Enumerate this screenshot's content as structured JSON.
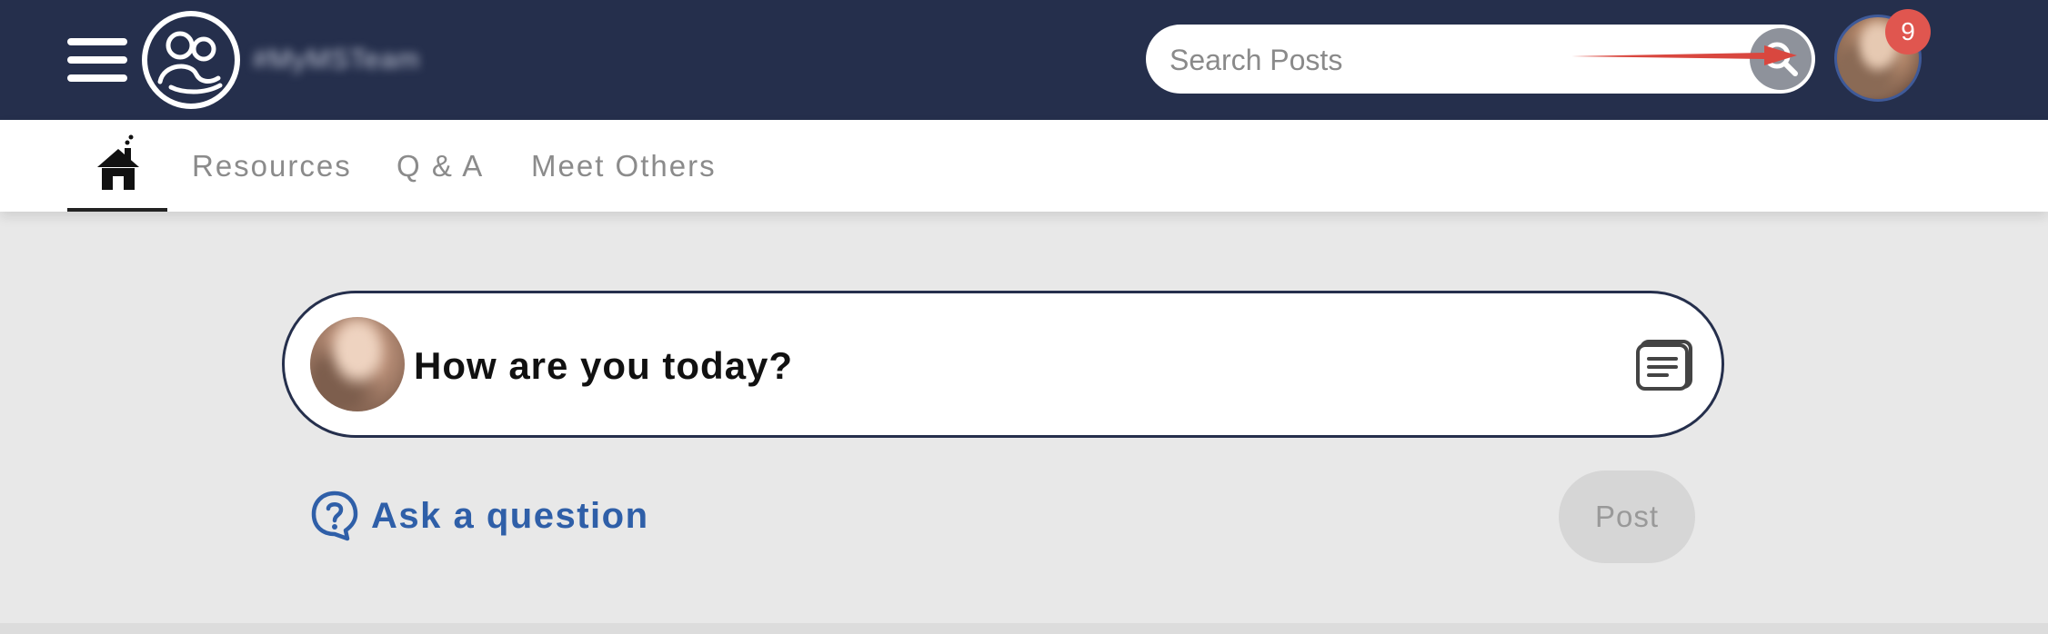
{
  "header": {
    "brand_name": "#MyMSTeam",
    "search": {
      "placeholder": "Search Posts"
    },
    "notification_count": "9",
    "icons": [
      "hamburger-menu-icon",
      "community-logo-icon",
      "search-icon",
      "user-avatar"
    ]
  },
  "subnav": {
    "tabs": [
      {
        "label": "Resources"
      },
      {
        "label": "Q & A"
      },
      {
        "label": "Meet Others"
      }
    ],
    "active_tab": "home"
  },
  "composer": {
    "prompt": "How are you today?",
    "ask_label": "Ask a question",
    "post_label": "Post"
  },
  "colors": {
    "header_bg": "#252f4c",
    "link_blue": "#2f5fa8",
    "badge_red": "#e0564f",
    "page_bg": "#e8e8e8"
  }
}
